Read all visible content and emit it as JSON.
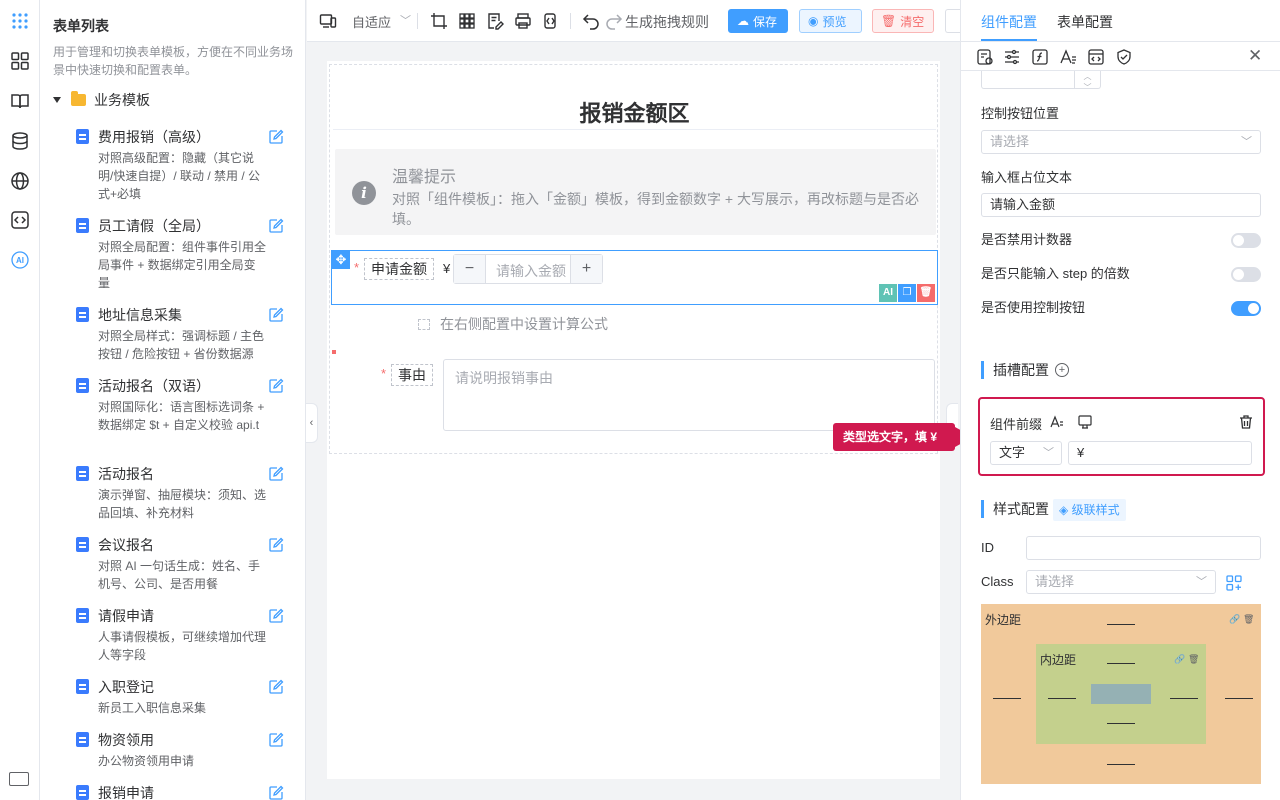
{
  "left_panel": {
    "title": "表单列表",
    "description": "用于管理和切换表单模板，方便在不同业务场景中快速切换和配置表单。",
    "group_label": "业务模板",
    "templates": [
      {
        "name": "费用报销（高级）",
        "desc": "对照高级配置：隐藏（其它说明/快速自提）/ 联动 / 禁用 / 公式+必填"
      },
      {
        "name": "员工请假（全局）",
        "desc": "对照全局配置：组件事件引用全局事件 + 数据绑定引用全局变量"
      },
      {
        "name": "地址信息采集",
        "desc": "对照全局样式：强调标题 / 主色按钮 / 危险按钮 + 省份数据源"
      },
      {
        "name": "活动报名（双语）",
        "desc": "对照国际化：语言图标选词条 + 数据绑定 $t + 自定义校验 api.t"
      },
      {
        "name": "活动报名",
        "desc": "演示弹窗、抽屉模块：须知、选品回填、补充材料"
      },
      {
        "name": "会议报名",
        "desc": "对照 AI 一句话生成：姓名、手机号、公司、是否用餐"
      },
      {
        "name": "请假申请",
        "desc": "人事请假模板，可继续增加代理人等字段"
      },
      {
        "name": "入职登记",
        "desc": "新员工入职信息采集"
      },
      {
        "name": "物资领用",
        "desc": "办公物资领用申请"
      },
      {
        "name": "报销申请",
        "desc": ""
      }
    ]
  },
  "toolbar": {
    "zoom_select": "自适应",
    "rule_label": "生成拖拽规则",
    "save_label": "保存",
    "preview_label": "预览",
    "clear_label": "清空"
  },
  "canvas": {
    "section_title": "报销金额区",
    "tip_title": "温馨提示",
    "tip_text": "对照「组件模板」：拖入「金额」模板，得到金额数字 + 大写展示，再改标题与是否必填。",
    "amount_label": "申请金额",
    "amount_prefix": "¥",
    "amount_placeholder": "请输入金额",
    "minus": "−",
    "plus": "+",
    "formula_hint": "在右侧配置中设置计算公式",
    "reason_label": "事由",
    "reason_placeholder": "请说明报销事由",
    "required_mark": "*",
    "ai_badge": "AI"
  },
  "callout": "类型选文字，填 ¥",
  "right_panel": {
    "tabs": [
      "组件配置",
      "表单配置"
    ],
    "control_position_label": "控制按钮位置",
    "control_position_placeholder": "请选择",
    "placeholder_label": "输入框占位文本",
    "placeholder_value": "请输入金额",
    "disable_counter_label": "是否禁用计数器",
    "step_only_label": "是否只能输入 step 的倍数",
    "use_control_label": "是否使用控制按钮",
    "switches": {
      "disable_counter": false,
      "step_only": false,
      "use_control": true
    },
    "slot_section": "插槽配置",
    "slot_name": "组件前缀",
    "slot_type": "文字",
    "slot_value": "¥",
    "style_section": "样式配置",
    "cascade_label": "级联样式",
    "id_label": "ID",
    "class_label": "Class",
    "class_placeholder": "请选择",
    "margin_label": "外边距",
    "padding_label": "内边距"
  }
}
